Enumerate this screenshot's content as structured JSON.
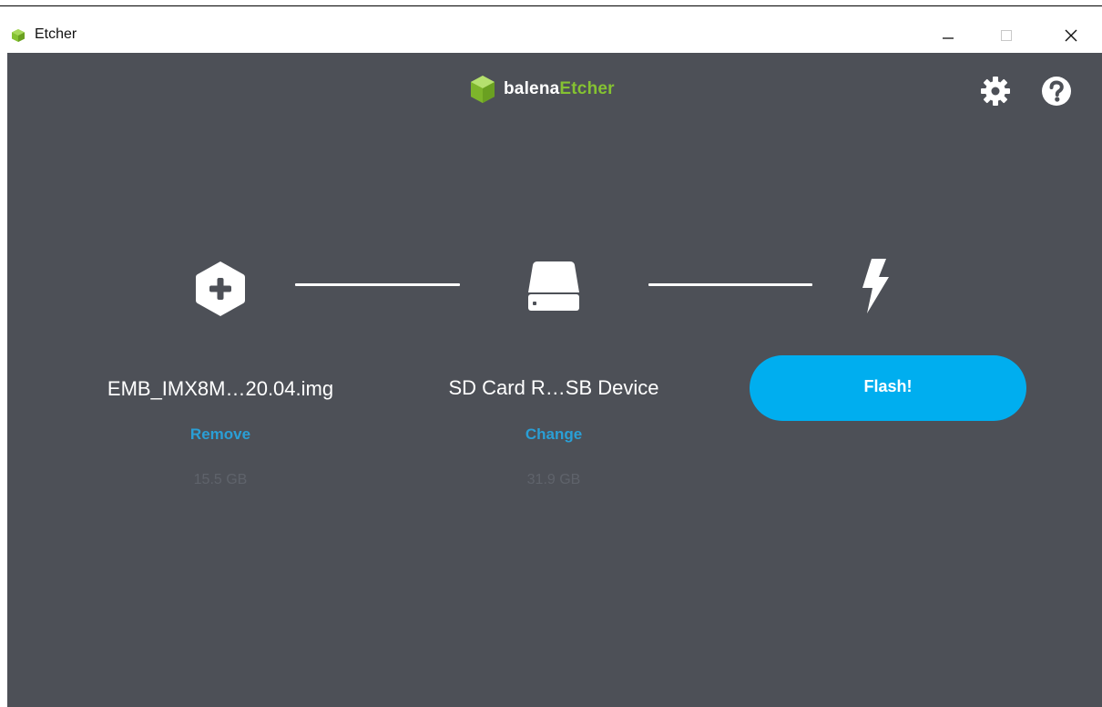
{
  "window": {
    "title": "Etcher",
    "icon": "etcher-app-icon",
    "controls": {
      "minimize_icon": "minimize-icon",
      "maximize_icon": "maximize-icon",
      "close_icon": "close-icon"
    }
  },
  "header": {
    "logo_part1": "balena",
    "logo_part2": "Etcher",
    "logo_icon": "balena-cube-icon",
    "settings_icon": "gear-icon",
    "help_icon": "question-circle-icon"
  },
  "steps": {
    "image": {
      "icon": "plus-hexagon-icon",
      "filename": "EMB_IMX8M…20.04.img",
      "action_label": "Remove",
      "size": "15.5 GB"
    },
    "drive": {
      "icon": "drive-icon",
      "name": "SD Card R…SB Device",
      "action_label": "Change",
      "size": "31.9 GB"
    },
    "flash": {
      "icon": "lightning-bolt-icon",
      "button_label": "Flash!"
    }
  },
  "colors": {
    "background": "#4d5057",
    "accent": "#00aeef",
    "link": "#2a9fd6",
    "brand_green": "#85c232",
    "muted_text": "#5f636b"
  }
}
